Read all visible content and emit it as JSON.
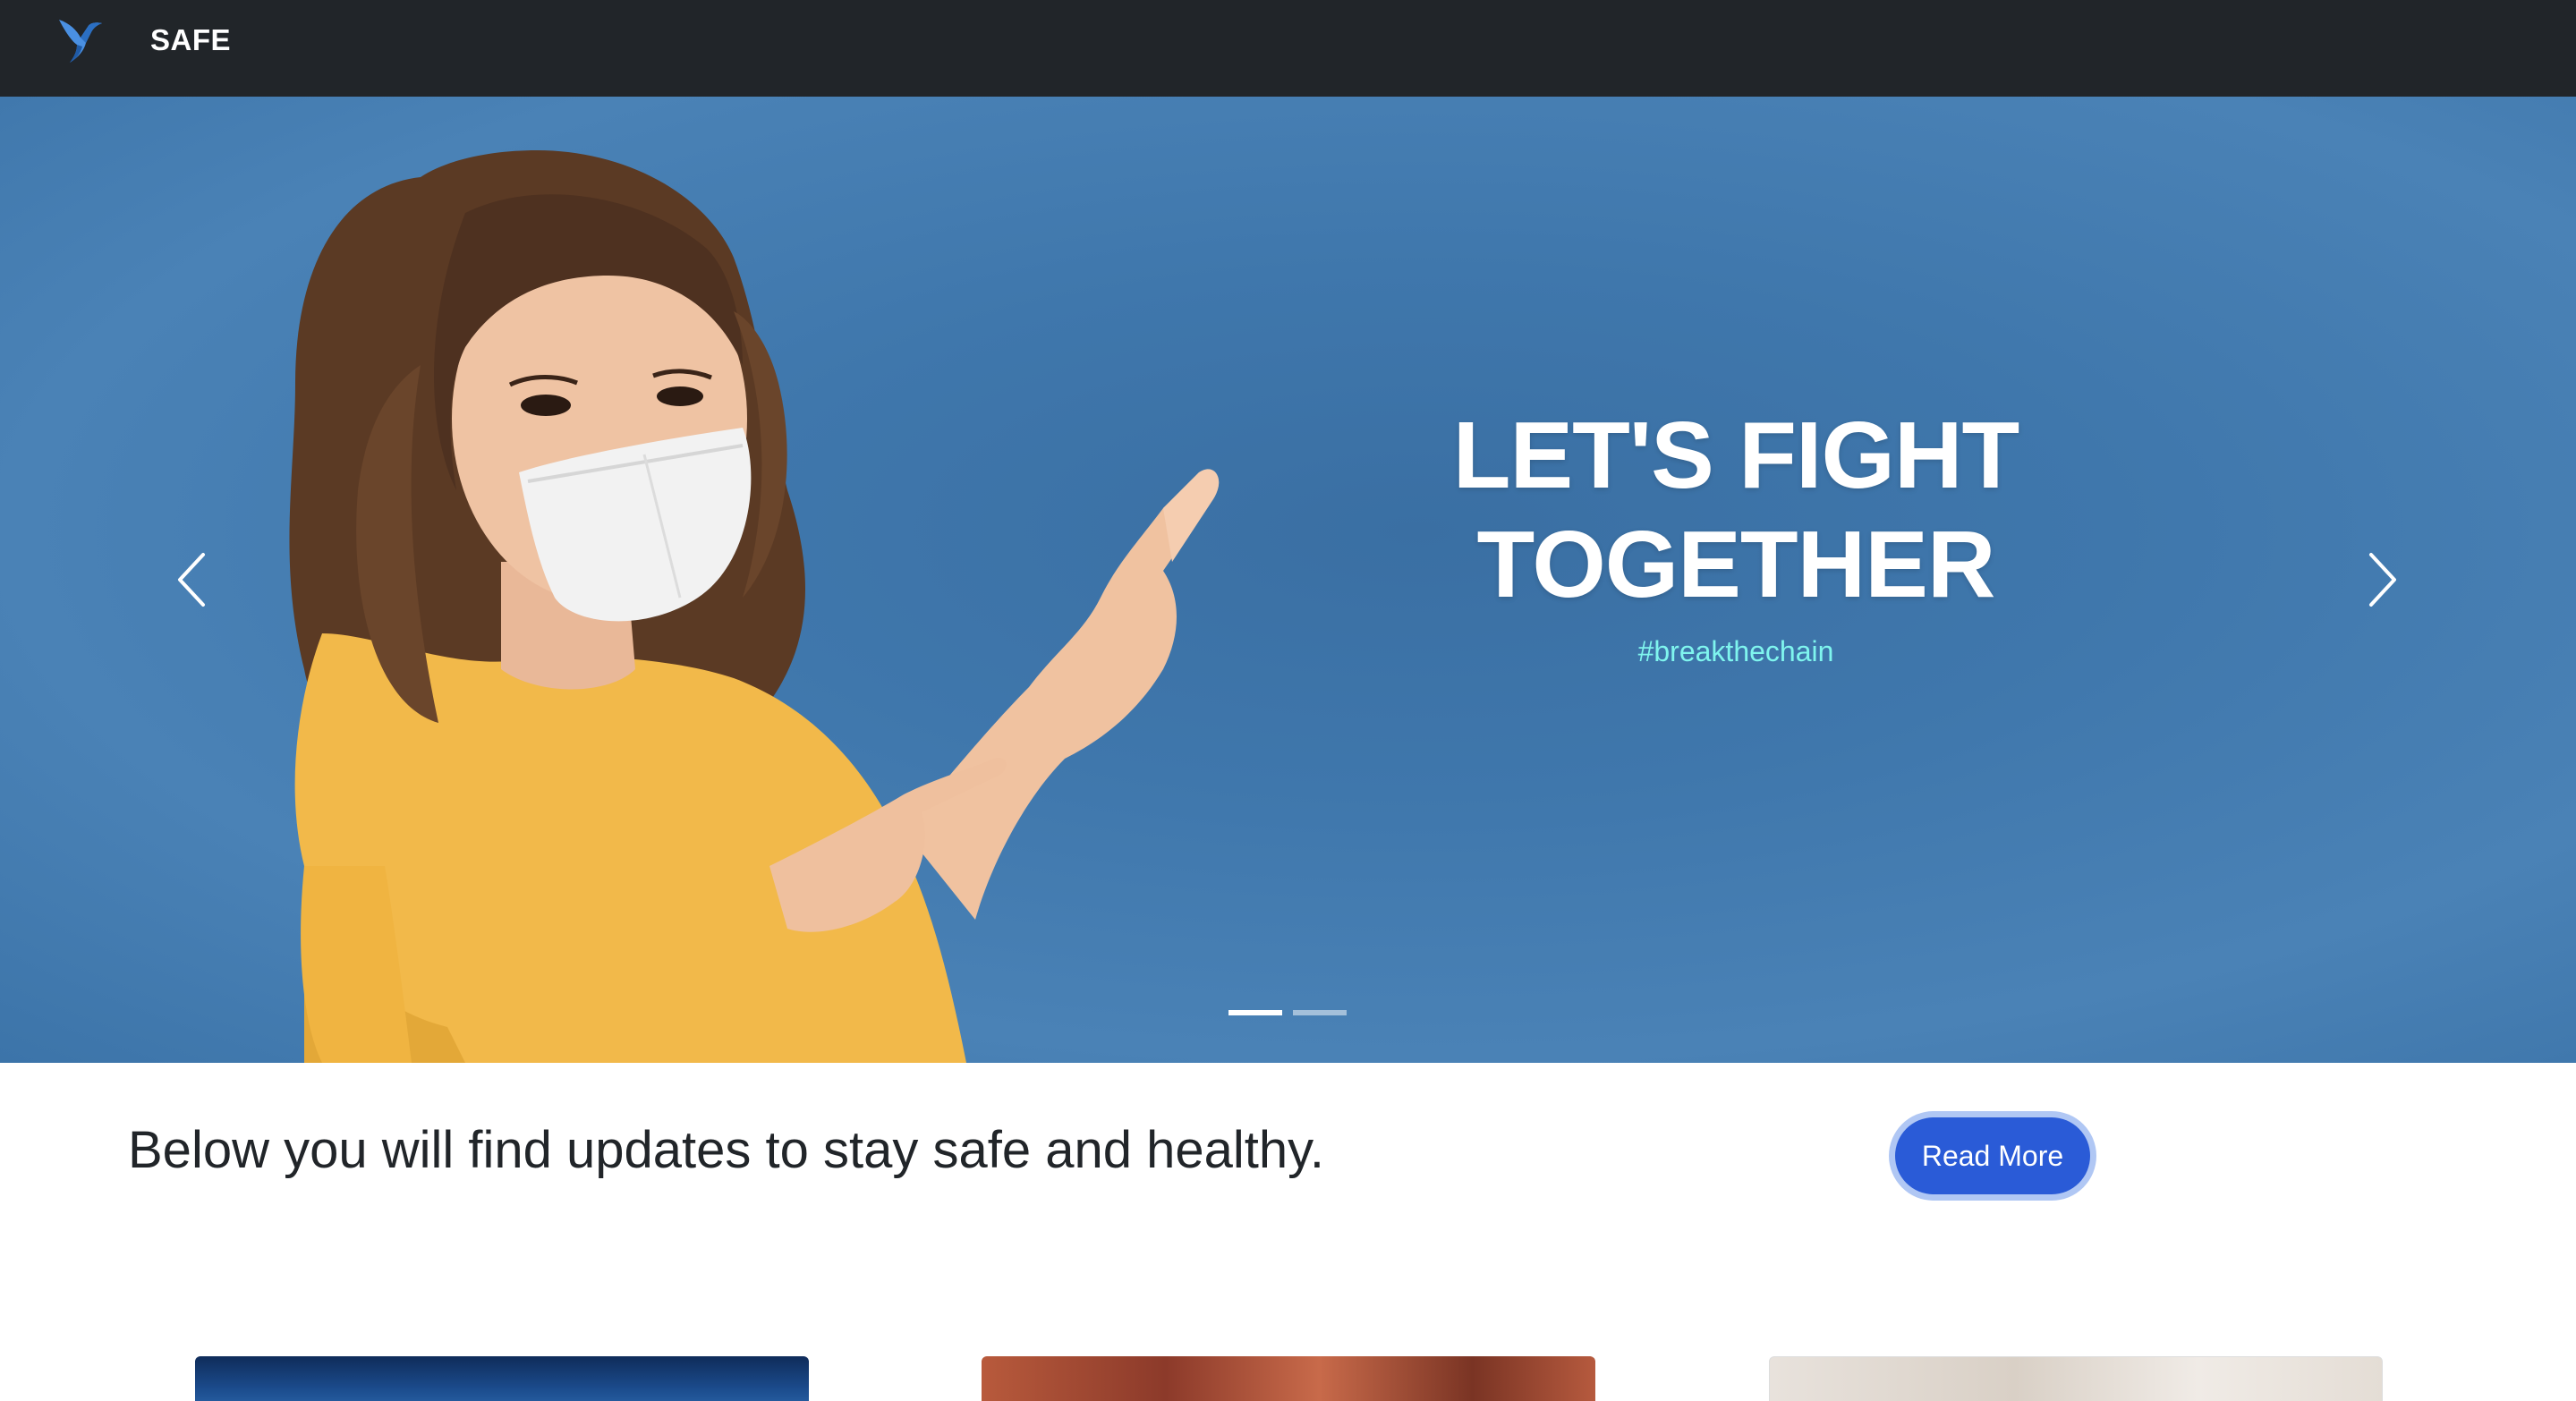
{
  "navbar": {
    "brand": "SAFE",
    "logo_icon": "hummingbird-logo-icon"
  },
  "hero": {
    "title_line1": "LET'S FIGHT",
    "title_line2": "TOGETHER",
    "hashtag": "#breakthechain",
    "prev_icon": "chevron-left-icon",
    "next_icon": "chevron-right-icon",
    "slides_count": 2,
    "active_slide": 1,
    "background_color": "#3f77ac",
    "hashtag_color": "#7ff5ee"
  },
  "intro": {
    "text": "Below you will find updates to stay safe and healthy.",
    "button_label": "Read More",
    "button_color": "#2a5bd7"
  },
  "cards": [
    {
      "image": "virus-image"
    },
    {
      "image": "cells-image"
    },
    {
      "image": "light-image"
    }
  ]
}
